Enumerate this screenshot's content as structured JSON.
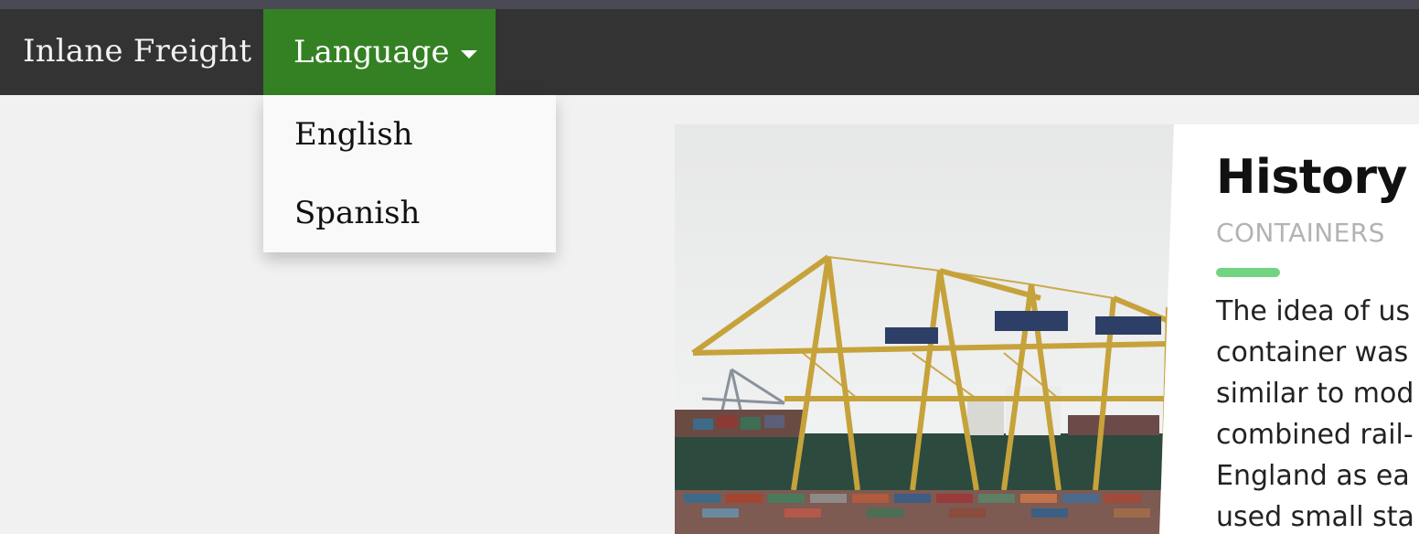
{
  "navbar": {
    "brand": "Inlane Freight",
    "language_label": "Language"
  },
  "language_menu": {
    "items": [
      "English",
      "Spanish"
    ]
  },
  "card": {
    "title": "History",
    "subtitle": "CONTAINERS",
    "text_lines": [
      "The idea of us",
      "container was",
      "similar to mod",
      "combined rail-",
      "England as ea",
      "used small sta"
    ],
    "image": "container-port-cranes"
  },
  "colors": {
    "navbar": "#333333",
    "active_nav": "#348124",
    "accent": "#72d381"
  }
}
